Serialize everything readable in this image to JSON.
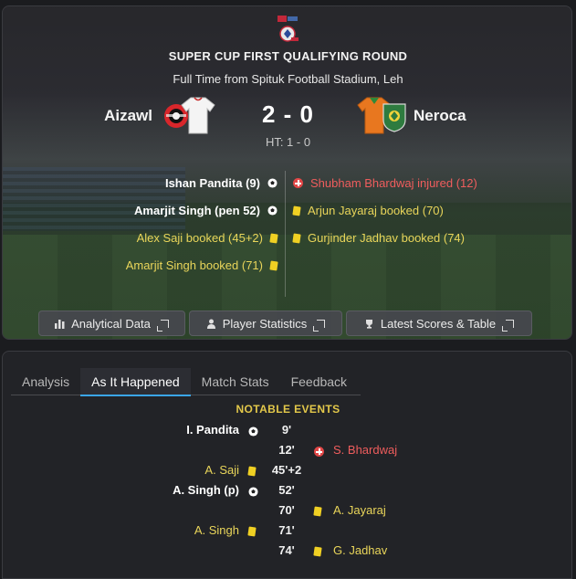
{
  "match": {
    "competition_title": "SUPER CUP FIRST QUALIFYING ROUND",
    "venue_line": "Full Time from Spituk Football Stadium, Leh",
    "home_team": "Aizawl",
    "away_team": "Neroca",
    "score": "2 - 0",
    "half_time": "HT: 1 - 0"
  },
  "home_events": [
    {
      "text": "Ishan Pandita (9)",
      "type": "goal"
    },
    {
      "text": "Amarjit Singh (pen 52)",
      "type": "goal"
    },
    {
      "text": "Alex Saji booked (45+2)",
      "type": "yellow"
    },
    {
      "text": "Amarjit Singh booked (71)",
      "type": "yellow"
    }
  ],
  "away_events": [
    {
      "text": "Shubham Bhardwaj injured (12)",
      "type": "injury"
    },
    {
      "text": "Arjun Jayaraj booked (70)",
      "type": "yellow"
    },
    {
      "text": "Gurjinder Jadhav booked (74)",
      "type": "yellow"
    }
  ],
  "buttons": {
    "analytical": "Analytical Data",
    "player_stats": "Player Statistics",
    "latest_scores": "Latest Scores & Table"
  },
  "tabs": [
    "Analysis",
    "As It Happened",
    "Match Stats",
    "Feedback"
  ],
  "active_tab": "As It Happened",
  "notable_title": "NOTABLE EVENTS",
  "timeline": [
    {
      "minute": "9'",
      "left": "I. Pandita",
      "left_type": "goal",
      "right": "",
      "right_type": ""
    },
    {
      "minute": "12'",
      "left": "",
      "left_type": "",
      "right": "S. Bhardwaj",
      "right_type": "injury"
    },
    {
      "minute": "45'+2",
      "left": "A. Saji",
      "left_type": "yellow",
      "right": "",
      "right_type": ""
    },
    {
      "minute": "52'",
      "left": "A. Singh (p)",
      "left_type": "goal",
      "right": "",
      "right_type": ""
    },
    {
      "minute": "70'",
      "left": "",
      "left_type": "",
      "right": "A. Jayaraj",
      "right_type": "yellow"
    },
    {
      "minute": "71'",
      "left": "A. Singh",
      "left_type": "yellow",
      "right": "",
      "right_type": ""
    },
    {
      "minute": "74'",
      "left": "",
      "left_type": "",
      "right": "G. Jadhav",
      "right_type": "yellow"
    }
  ],
  "colors": {
    "goal_text": "#ffffff",
    "booking_text": "#e9d55a",
    "injury_text": "#ef5d5d",
    "active_tab_underline": "#3aa6e8",
    "notable_title": "#e3c84a",
    "neroca_kit": "#e8771f"
  },
  "icons": {
    "goal": "football-icon",
    "yellow": "yellow-card-icon",
    "injury": "injury-cross-icon",
    "external": "external-link-icon"
  }
}
